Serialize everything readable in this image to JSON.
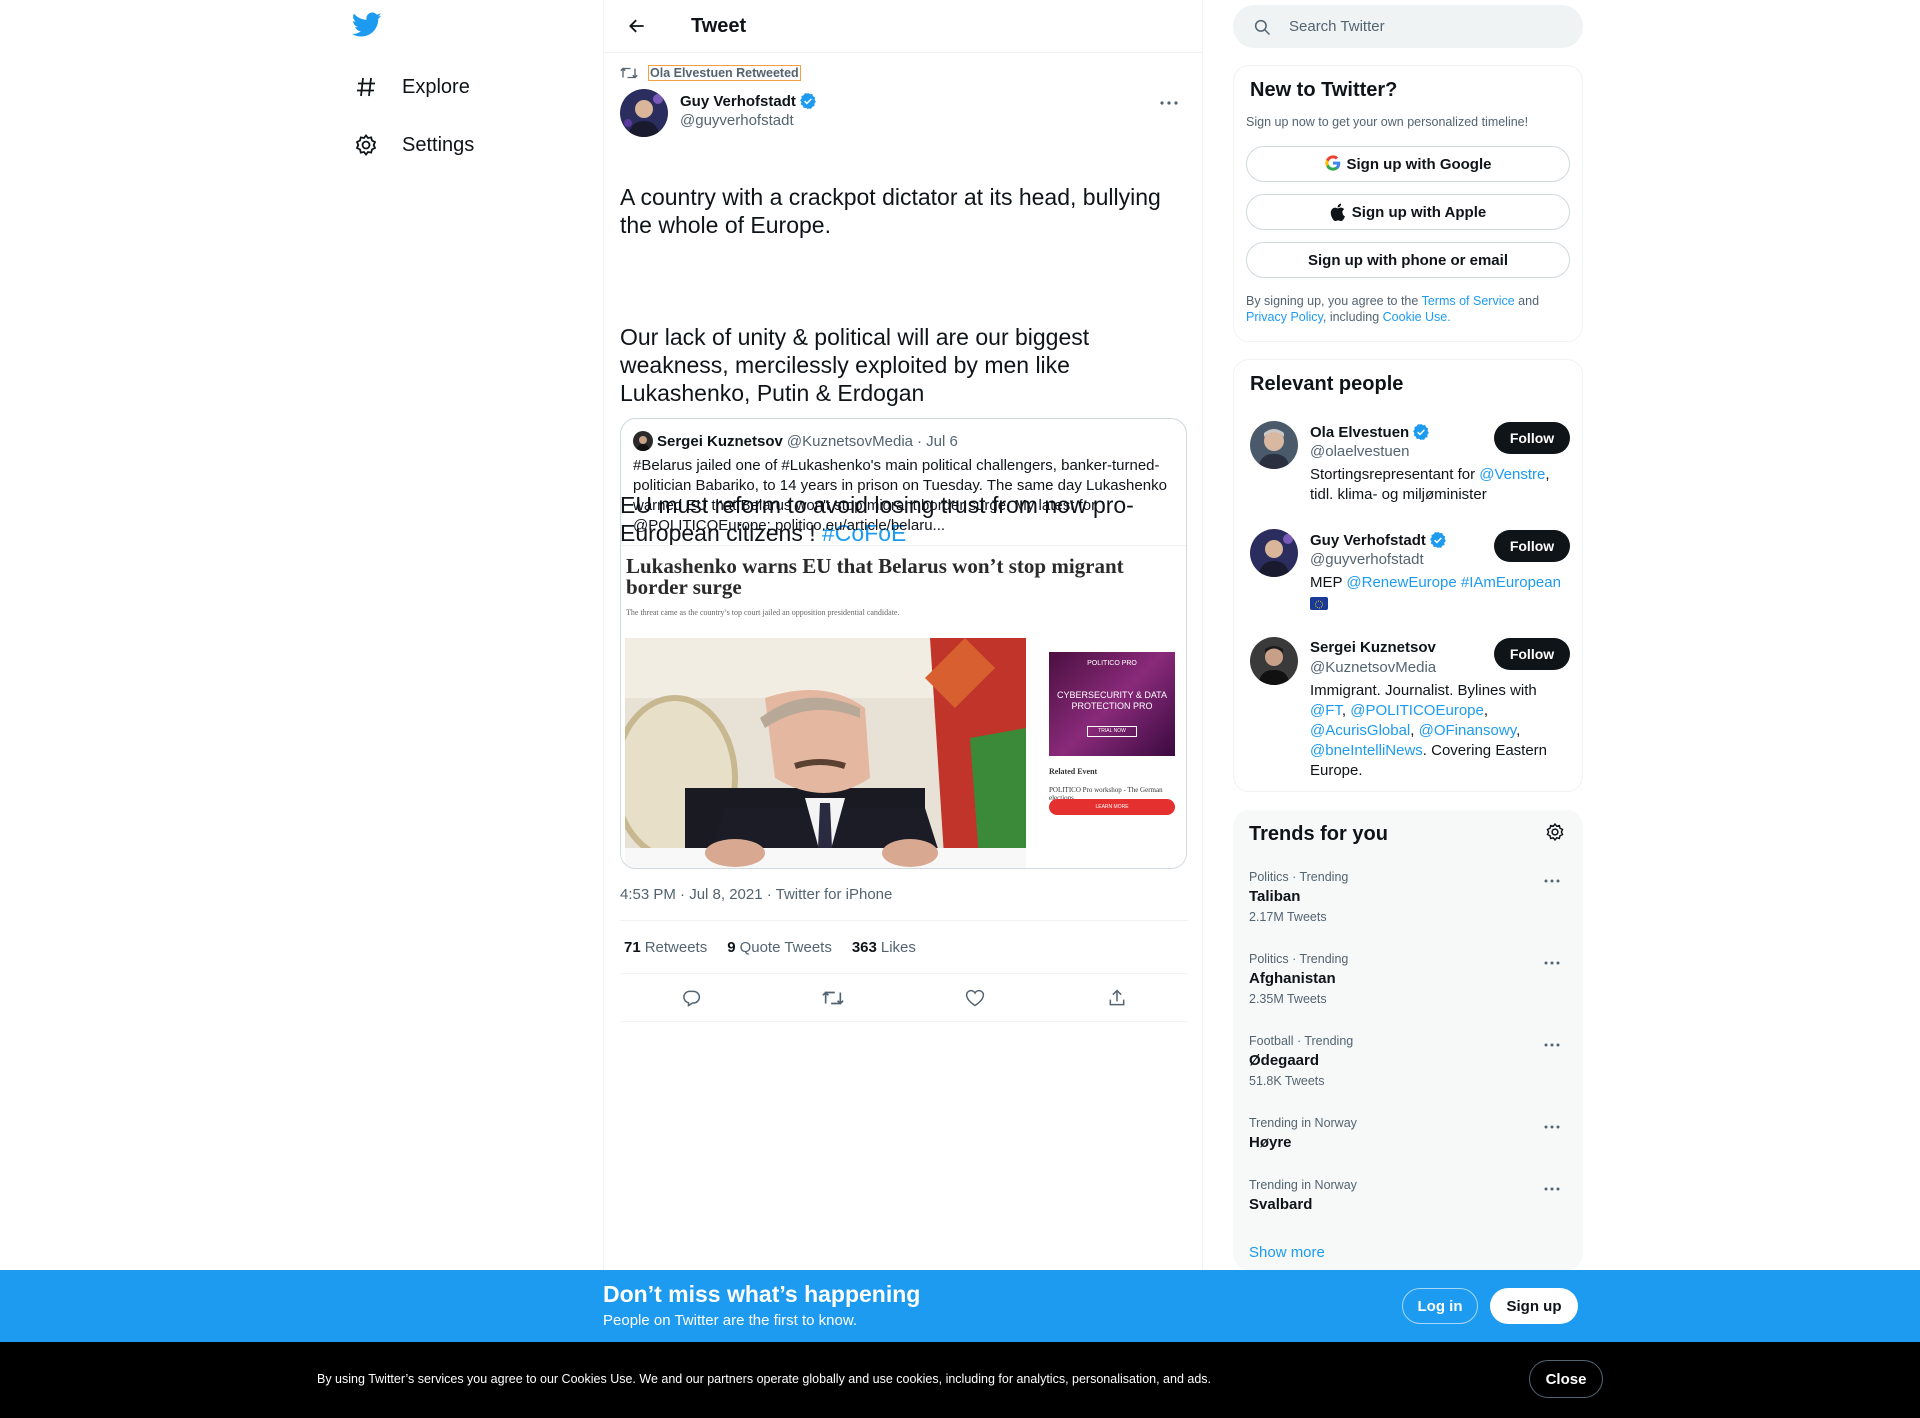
{
  "nav": {
    "explore_label": "Explore",
    "settings_label": "Settings"
  },
  "header": {
    "title": "Tweet"
  },
  "tweet": {
    "retweeted_by": "Ola Elvestuen Retweeted",
    "author_name": "Guy Verhofstadt",
    "author_handle": "@guyverhofstadt",
    "text_p1": "A country with a crackpot dictator at its head, bullying the whole of Europe.",
    "text_p2": "Our lack of unity & political will are our biggest weakness, mercilessly exploited by men like Lukashenko, Putin & Erdogan",
    "text_p3": "EU must reform to avoid losing trust from now pro-European citizens ! ",
    "hashtag": "#CoFoE",
    "timestamp": "4:53 PM · Jul 8, 2021 · Twitter for iPhone",
    "retweets_count": "71",
    "retweets_label": "Retweets",
    "quotes_count": "9",
    "quotes_label": "Quote Tweets",
    "likes_count": "363",
    "likes_label": "Likes"
  },
  "quote": {
    "author_name": "Sergei Kuznetsov",
    "author_handle": "@KuznetsovMedia",
    "date": "· Jul 6",
    "text": "#Belarus jailed one of #Lukashenko's main political challengers, banker-turned-politician Babariko, to 14 years in prison on Tuesday. The same day Lukashenko warned EU that Belarus won't stop migrant border surge. My latest for @POLITICOEurope: politico.eu/article/belaru...",
    "image_headline": "Lukashenko warns EU that Belarus won’t stop migrant border surge",
    "image_subline": "The threat came as the country’s top court jailed an opposition presidential candidate.",
    "ad_brand": "POLITICO PRO",
    "ad_title": "CYBERSECURITY & DATA PROTECTION PRO",
    "ad_button": "TRIAL NOW",
    "related_title": "Related Event",
    "related_text": "POLITICO Pro workshop - The German elections",
    "red_button": "LEARN MORE"
  },
  "search": {
    "placeholder": "Search Twitter"
  },
  "new_to_twitter": {
    "title": "New to Twitter?",
    "subtitle": "Sign up now to get your own personalized timeline!",
    "google_label": "Sign up with Google",
    "apple_label": "Sign up with Apple",
    "phone_label": "Sign up with phone or email",
    "terms_prefix": "By signing up, you agree to the ",
    "terms_link": "Terms of Service",
    "terms_and": " and ",
    "privacy_link": "Privacy Policy",
    "terms_including": ", including ",
    "cookie_link": "Cookie Use."
  },
  "relevant_people": {
    "title": "Relevant people",
    "people": [
      {
        "name": "Ola Elvestuen",
        "handle": "@olaelvestuen",
        "bio_prefix": "Stortingsrepresentant for ",
        "bio_link": "@Venstre",
        "bio_suffix": ", tidl. klima- og miljøminister",
        "follow": "Follow"
      },
      {
        "name": "Guy Verhofstadt",
        "handle": "@guyverhofstadt",
        "bio_prefix": "MEP ",
        "bio_link1": "@RenewEurope",
        "bio_link2": "#IAmEuropean",
        "follow": "Follow"
      },
      {
        "name": "Sergei Kuznetsov",
        "handle": "@KuznetsovMedia",
        "bio_prefix": "Immigrant. Journalist. Bylines with ",
        "bio_link1": "@FT",
        "bio_link2": "@POLITICOEurope",
        "bio_link3": "@AcurisGlobal",
        "bio_link4": "@OFinansowy",
        "bio_link5": "@bneIntelliNews",
        "bio_suffix": ". Covering Eastern Europe.",
        "follow": "Follow"
      }
    ]
  },
  "trends": {
    "title": "Trends for you",
    "items": [
      {
        "meta": "Politics · Trending",
        "name": "Taliban",
        "count": "2.17M Tweets"
      },
      {
        "meta": "Politics · Trending",
        "name": "Afghanistan",
        "count": "2.35M Tweets"
      },
      {
        "meta": "Football · Trending",
        "name": "Ødegaard",
        "count": "51.8K Tweets"
      },
      {
        "meta": "Trending in Norway",
        "name": "Høyre",
        "count": ""
      },
      {
        "meta": "Trending in Norway",
        "name": "Svalbard",
        "count": ""
      }
    ],
    "show_more": "Show more"
  },
  "signup_bar": {
    "title": "Don’t miss what’s happening",
    "subtitle": "People on Twitter are the first to know.",
    "login": "Log in",
    "signup": "Sign up"
  },
  "cookie_bar": {
    "text": "By using Twitter’s services you agree to our Cookies Use. We and our partners operate globally and use cookies, including for analytics, personalisation, and ads.",
    "close": "Close"
  },
  "colors": {
    "accent": "#1d9bf0",
    "text": "#0f1419",
    "secondary": "#536471",
    "cookie_bg": "#000000"
  },
  "icons": [
    "twitter-logo-icon",
    "hashtag-icon",
    "gear-icon",
    "back-arrow-icon",
    "retweet-icon",
    "verified-icon",
    "more-icon",
    "reply-icon",
    "like-icon",
    "share-icon",
    "search-icon",
    "google-icon",
    "apple-icon"
  ]
}
